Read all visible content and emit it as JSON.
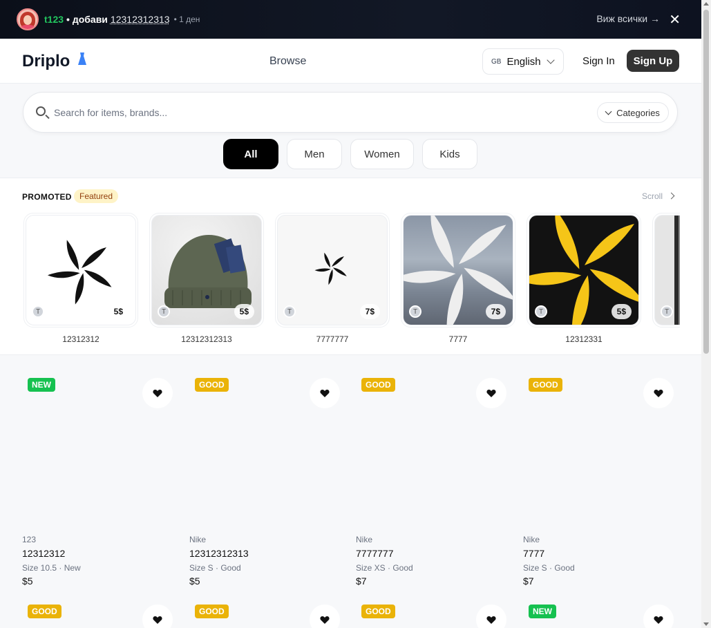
{
  "notification": {
    "user": "t123",
    "action": "• добави",
    "item": "12312312313",
    "time": "• 1 ден",
    "see_all": "Виж всички →",
    "close_icon": "close-icon"
  },
  "header": {
    "logo": "Driplo",
    "logo_icon": "dress-icon",
    "browse": "Browse",
    "language_code": "GB",
    "language": "English",
    "sign_in": "Sign In",
    "sign_up": "Sign Up"
  },
  "search": {
    "placeholder": "Search for items, brands...",
    "categories": "Categories"
  },
  "filters": [
    "All",
    "Men",
    "Women",
    "Kids"
  ],
  "promoted": {
    "label": "PROMOTED",
    "badge": "Featured",
    "scroll": "Scroll",
    "items": [
      {
        "name": "12312312",
        "price": "5$",
        "seller": "T"
      },
      {
        "name": "12312312313",
        "price": "5$",
        "seller": "T"
      },
      {
        "name": "7777777",
        "price": "7$",
        "seller": "T"
      },
      {
        "name": "7777",
        "price": "7$",
        "seller": "T"
      },
      {
        "name": "12312331",
        "price": "5$",
        "seller": "T"
      },
      {
        "name": "",
        "price": "",
        "seller": "T"
      }
    ]
  },
  "products": [
    {
      "badge": "NEW",
      "brand": "123",
      "title": "12312312",
      "meta": "Size 10.5 · New",
      "price": "$5"
    },
    {
      "badge": "GOOD",
      "brand": "Nike",
      "title": "12312312313",
      "meta": "Size S · Good",
      "price": "$5"
    },
    {
      "badge": "GOOD",
      "brand": "Nike",
      "title": "7777777",
      "meta": "Size XS · Good",
      "price": "$7"
    },
    {
      "badge": "GOOD",
      "brand": "Nike",
      "title": "7777",
      "meta": "Size S · Good",
      "price": "$7"
    },
    {
      "badge": "GOOD"
    },
    {
      "badge": "GOOD"
    },
    {
      "badge": "GOOD"
    },
    {
      "badge": "NEW"
    }
  ],
  "colors": {
    "accent": "#333333",
    "new_badge": "#16c150",
    "good_badge": "#eab308",
    "featured_bg": "#fef3c7"
  }
}
